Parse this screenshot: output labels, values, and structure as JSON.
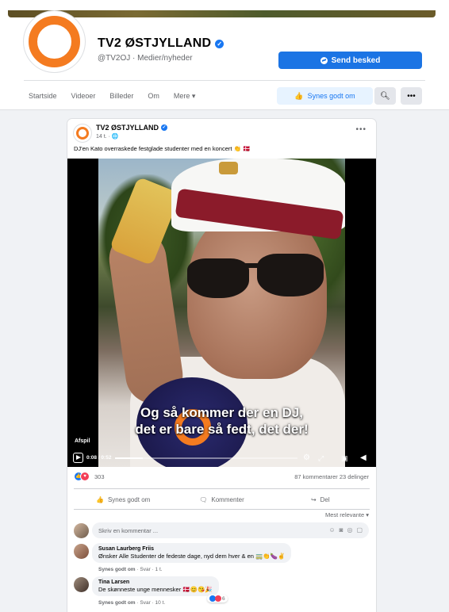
{
  "page": {
    "name": "TV2 ØSTJYLLAND",
    "handle_category": "@TV2OJ · Medier/nyheder",
    "send_message_label": "Send besked",
    "tabs": [
      "Startside",
      "Videoer",
      "Billeder",
      "Om",
      "Mere ▾"
    ],
    "like_button_label": "Synes godt om",
    "accent_color": "#1b74e4",
    "brand_color": "#f47b20"
  },
  "post": {
    "author": "TV2 ØSTJYLLAND",
    "time": "14 t. · 🌐",
    "text": "DJ'en Kato overraskede festglade studenter med en koncert 👏 🇩🇰",
    "video": {
      "subtitle_line1": "Og så kommer der en DJ,",
      "subtitle_line2": "det er bare så fedt, det der!",
      "play_hint": "Afspil",
      "time": "0:08 / 0:52",
      "progress": 0.15
    },
    "reaction_count": "303",
    "comments_shares": "87 kommentarer  23 delinger",
    "actions": {
      "like": "Synes godt om",
      "comment": "Kommenter",
      "share": "Del"
    },
    "sort_label": "Mest relevante ▾",
    "composer_placeholder": "Skriv en kommentar ...",
    "comments": [
      {
        "name": "Susan Laurberg Friis",
        "text": "Ønsker Alle Studenter de fedeste dage, nyd dem hver & en 🚃👏🍆✌",
        "like": "Synes godt om",
        "reply": "Svar",
        "time": "1 t."
      },
      {
        "name": "Tina Larsen",
        "text": "De skønneste unge mennesker 🇩🇰😊😘🎉",
        "like": "Synes godt om",
        "reply": "Svar",
        "time": "10 t.",
        "reactions": "6"
      }
    ]
  }
}
